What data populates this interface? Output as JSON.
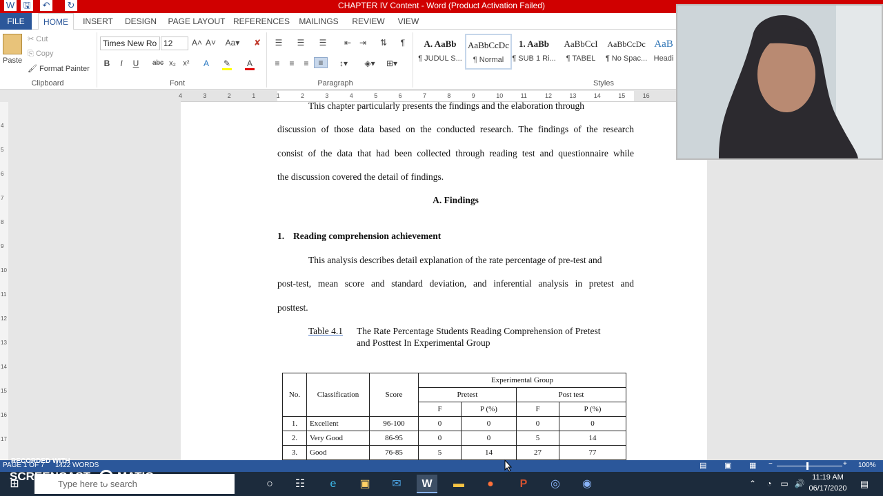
{
  "window": {
    "title": "CHAPTER IV Content - Word (Product Activation Failed)"
  },
  "tabs": [
    "FILE",
    "HOME",
    "INSERT",
    "DESIGN",
    "PAGE LAYOUT",
    "REFERENCES",
    "MAILINGS",
    "REVIEW",
    "VIEW"
  ],
  "ribbon": {
    "clipboard": {
      "paste": "Paste",
      "cut": "Cut",
      "copy": "Copy",
      "format_painter": "Format Painter",
      "label": "Clipboard"
    },
    "font": {
      "name": "Times New Ro",
      "size": "12",
      "label": "Font"
    },
    "paragraph": {
      "label": "Paragraph"
    },
    "styles": {
      "label": "Styles",
      "items": [
        {
          "preview": "A.  AaBb",
          "name": "¶ JUDUL S..."
        },
        {
          "preview": "AaBbCcDc",
          "name": "¶ Normal"
        },
        {
          "preview": "1.  AaBb",
          "name": "¶ SUB 1 Ri..."
        },
        {
          "preview": "AaBbCcI",
          "name": "¶ TABEL"
        },
        {
          "preview": "AaBbCcDc",
          "name": "¶ No Spac..."
        },
        {
          "preview": "AaB",
          "name": "Headi"
        }
      ]
    }
  },
  "ruler": {
    "ticks": [
      "4",
      "3",
      "2",
      "1",
      "1",
      "2",
      "3",
      "4",
      "5",
      "6",
      "7",
      "8",
      "9",
      "10",
      "11",
      "12",
      "13",
      "14",
      "15",
      "16"
    ],
    "vticks": [
      "4",
      "5",
      "6",
      "7",
      "8",
      "9",
      "10",
      "11",
      "12",
      "13",
      "14",
      "15",
      "16",
      "17"
    ]
  },
  "document": {
    "line1": "This chapter particularly presents the findings and the elaboration through",
    "line2": "discussion of those data based on the conducted research. The findings of the research",
    "line3": "consist of the data that had been collected through reading test and questionnaire while",
    "line4": "the discussion covered the detail of findings.",
    "heading": "A.  Findings",
    "subheading_num": "1.",
    "subheading": "Reading comprehension achievement",
    "p2_line1": "This analysis describes detail explanation of the rate percentage of pre-test and",
    "p2_line2": "post-test, mean score and standard deviation, and inferential analysis in pretest and",
    "p2_line3": "posttest.",
    "table_caption_label": "Table 4.1",
    "table_caption_line1": "The Rate Percentage Students Reading Comprehension of Pretest",
    "table_caption_line2": "and Posttest In Experimental Group"
  },
  "table": {
    "h_no": "No.",
    "h_class": "Classification",
    "h_score": "Score",
    "h_group": "Experimental Group",
    "h_pre": "Pretest",
    "h_post": "Post test",
    "h_f": "F",
    "h_p": "P (%)",
    "rows": [
      {
        "no": "1.",
        "class": "Excellent",
        "score": "96-100",
        "pre_f": "0",
        "pre_p": "0",
        "post_f": "0",
        "post_p": "0"
      },
      {
        "no": "2.",
        "class": "Very Good",
        "score": "86-95",
        "pre_f": "0",
        "pre_p": "0",
        "post_f": "5",
        "post_p": "14"
      },
      {
        "no": "3.",
        "class": "Good",
        "score": "76-85",
        "pre_f": "5",
        "pre_p": "14",
        "post_f": "27",
        "post_p": "77"
      }
    ]
  },
  "status": {
    "page": "PAGE 1 OF 7",
    "words": "1422 WORDS",
    "zoom": "100%"
  },
  "taskbar": {
    "search": "Type here to search",
    "time": "11:19 AM",
    "date": "06/17/2020"
  },
  "watermark": {
    "recorded": "RECORDED WITH",
    "brand": "SCREENCAST",
    "brand2": "MATIC"
  },
  "colors": {
    "accent": "#2b579a",
    "title_bar": "#d00000",
    "taskbar": "#1c2b3c"
  }
}
